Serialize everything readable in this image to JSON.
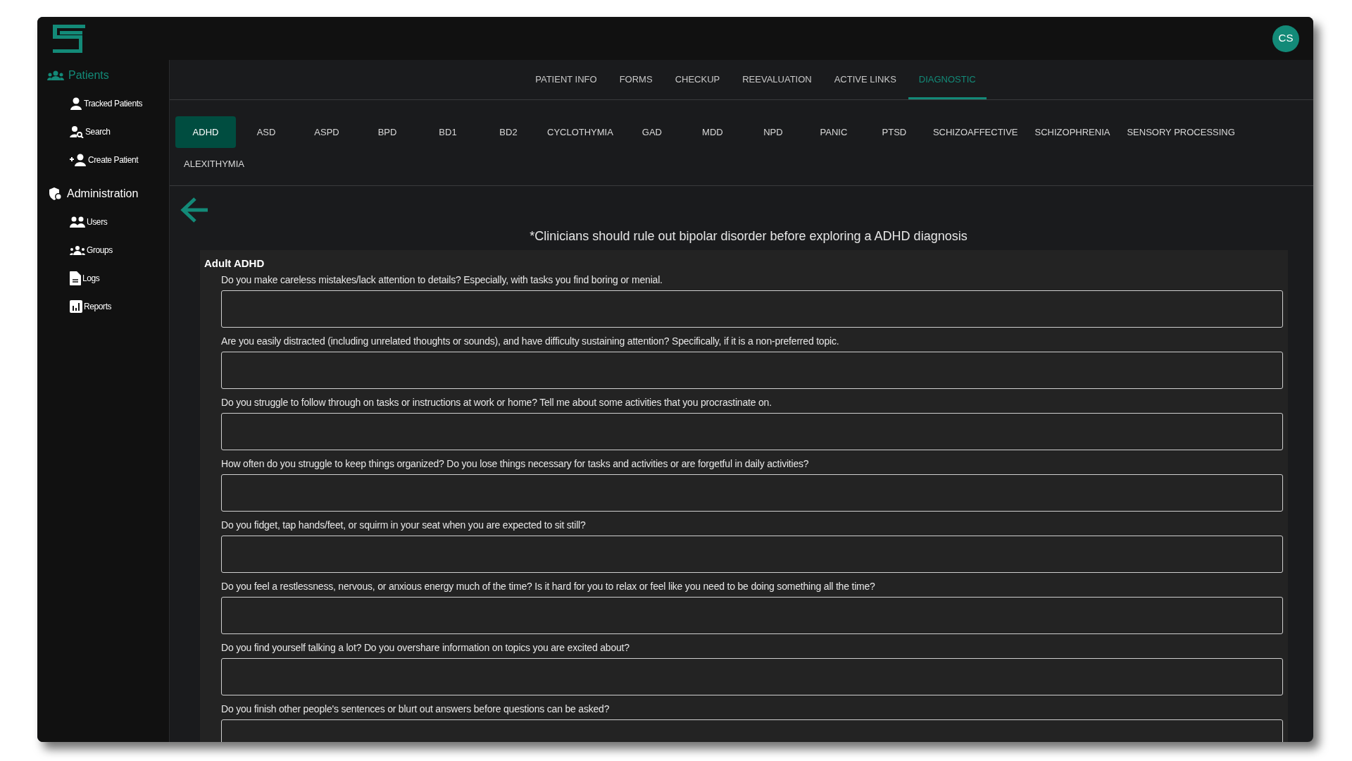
{
  "header": {
    "avatar": "CS"
  },
  "sidebar": {
    "sections": [
      {
        "label": "Patients",
        "selected": true,
        "items": [
          {
            "label": "Tracked Patients"
          },
          {
            "label": "Search"
          },
          {
            "label": "Create Patient"
          }
        ]
      },
      {
        "label": "Administration",
        "selected": false,
        "items": [
          {
            "label": "Users"
          },
          {
            "label": "Groups"
          },
          {
            "label": "Logs"
          },
          {
            "label": "Reports"
          }
        ]
      }
    ]
  },
  "tabs": [
    {
      "label": "PATIENT INFO",
      "selected": false
    },
    {
      "label": "FORMS",
      "selected": false
    },
    {
      "label": "CHECKUP",
      "selected": false
    },
    {
      "label": "REEVALUATION",
      "selected": false
    },
    {
      "label": "ACTIVE LINKS",
      "selected": false
    },
    {
      "label": "DIAGNOSTIC",
      "selected": true
    }
  ],
  "diagnostic_tabs": [
    {
      "label": "ADHD",
      "selected": true
    },
    {
      "label": "ASD",
      "selected": false
    },
    {
      "label": "ASPD",
      "selected": false
    },
    {
      "label": "BPD",
      "selected": false
    },
    {
      "label": "BD1",
      "selected": false
    },
    {
      "label": "BD2",
      "selected": false
    },
    {
      "label": "CYCLOTHYMIA",
      "selected": false
    },
    {
      "label": "GAD",
      "selected": false
    },
    {
      "label": "MDD",
      "selected": false
    },
    {
      "label": "NPD",
      "selected": false
    },
    {
      "label": "PANIC",
      "selected": false
    },
    {
      "label": "PTSD",
      "selected": false
    },
    {
      "label": "SCHIZOAFFECTIVE",
      "selected": false
    },
    {
      "label": "SCHIZOPHRENIA",
      "selected": false
    },
    {
      "label": "SENSORY PROCESSING",
      "selected": false
    },
    {
      "label": "ALEXITHYMIA",
      "selected": false
    }
  ],
  "notice": "*Clinicians should rule out bipolar disorder before exploring a ADHD diagnosis",
  "form": {
    "title": "Adult ADHD",
    "questions": [
      "Do you make careless mistakes/lack attention to details? Especially, with tasks you find boring or menial.",
      "Are you easily distracted (including unrelated thoughts or sounds), and have difficulty sustaining attention? Specifically, if it is a non-preferred topic.",
      "Do you struggle to follow through on tasks or instructions at work or home? Tell me about some activities that you procrastinate on.",
      "How often do you struggle to keep things organized? Do you lose things necessary for tasks and activities or are forgetful in daily activities?",
      "Do you fidget, tap hands/feet, or squirm in your seat when you are expected to sit still?",
      "Do you feel a restlessness, nervous, or anxious energy much of the time? Is it hard for you to relax or feel like you need to be doing something all the time?",
      "Do you find yourself talking a lot? Do you overshare information on topics you are excited about?",
      "Do you finish other people's sentences or blurt out answers before questions can be asked?"
    ]
  }
}
